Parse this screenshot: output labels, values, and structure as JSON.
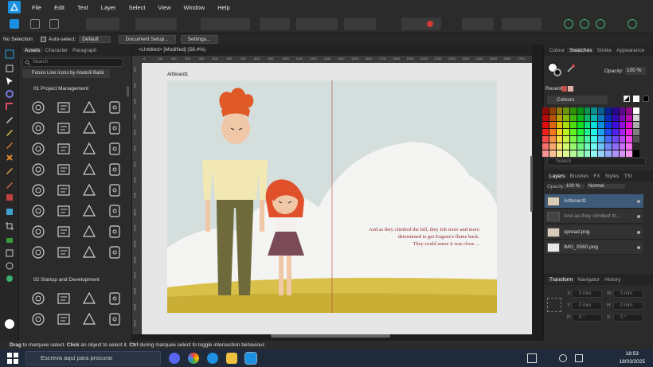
{
  "menu": {
    "items": [
      "File",
      "Edit",
      "Text",
      "Layer",
      "Select",
      "View",
      "Window",
      "Help"
    ]
  },
  "context": {
    "selection": "No Selection",
    "auto_select_label": "Auto-select:",
    "auto_select_value": "Default",
    "doc_setup": "Document Setup...",
    "settings": "Settings..."
  },
  "assets_panel": {
    "tabs": [
      "Assets",
      "Character",
      "Paragraph"
    ],
    "search_placeholder": "Search",
    "category": "Futuro Line Icons by Anatolii Babii",
    "sections": [
      "01 Project Management",
      "02 Startup and Development"
    ]
  },
  "document": {
    "tab_title": "<Untitled> [Modified] (58.4%)",
    "artboard_label": "Artboard1",
    "story_text": [
      "And as they climbed the hill, they felt more and more",
      "determined to get Eugene's flame back.",
      "They could sense it was close ..."
    ],
    "ruler_h": [
      "0",
      "100",
      "200",
      "300",
      "400",
      "500",
      "600",
      "700",
      "800",
      "900",
      "1000",
      "1100",
      "1200",
      "1300",
      "1400",
      "1500",
      "1600",
      "1700",
      "1800",
      "1900",
      "2000",
      "2100",
      "2200",
      "2300",
      "2400",
      "2500",
      "2600",
      "2700"
    ],
    "ruler_v": [
      "100",
      "200",
      "300",
      "400",
      "500",
      "600",
      "700",
      "800",
      "900",
      "1000",
      "1100",
      "1200",
      "1300",
      "1400",
      "1500",
      "1600",
      "1700"
    ]
  },
  "colour_panel": {
    "tabs": [
      "Colour",
      "Swatches",
      "Stroke",
      "Appearance"
    ],
    "opacity_label": "Opacity:",
    "opacity_value": "100 %",
    "recent_label": "Recent:",
    "palette": "Colours",
    "search_placeholder": "Search"
  },
  "layers_panel": {
    "tabs": [
      "Layers",
      "Brushes",
      "FX",
      "Styles",
      "TSt"
    ],
    "opacity_label": "Opacity:",
    "opacity_value": "100 %",
    "blend_mode": "Normal",
    "layers": [
      "Artboard1",
      "And as they climbed th...",
      "spread.png",
      "IMG_0560.png"
    ]
  },
  "transform_panel": {
    "tabs": [
      "Transform",
      "Navigator",
      "History"
    ],
    "fields": [
      {
        "label": "X:",
        "value": "0 mm"
      },
      {
        "label": "W:",
        "value": "0 mm"
      },
      {
        "label": "Y:",
        "value": "0 mm"
      },
      {
        "label": "H:",
        "value": "0 mm"
      },
      {
        "label": "R:",
        "value": "0 °"
      },
      {
        "label": "S:",
        "value": "0 °"
      }
    ]
  },
  "status_bar": {
    "p1": "Drag",
    "p2": " to marquee select. ",
    "p3": "Click",
    "p4": " an object to select it. ",
    "p5": "Ctrl",
    "p6": " during marquee select to toggle intersection behaviour."
  },
  "taskbar": {
    "search_placeholder": "Escreva aqui para procurar",
    "time": "18:53",
    "date": "18/03/2025"
  },
  "colors": {
    "sky": "#d4dfdd",
    "grass": "#d8c04a",
    "text_red": "#8c2f2f",
    "accent": "#1b8fe0"
  }
}
